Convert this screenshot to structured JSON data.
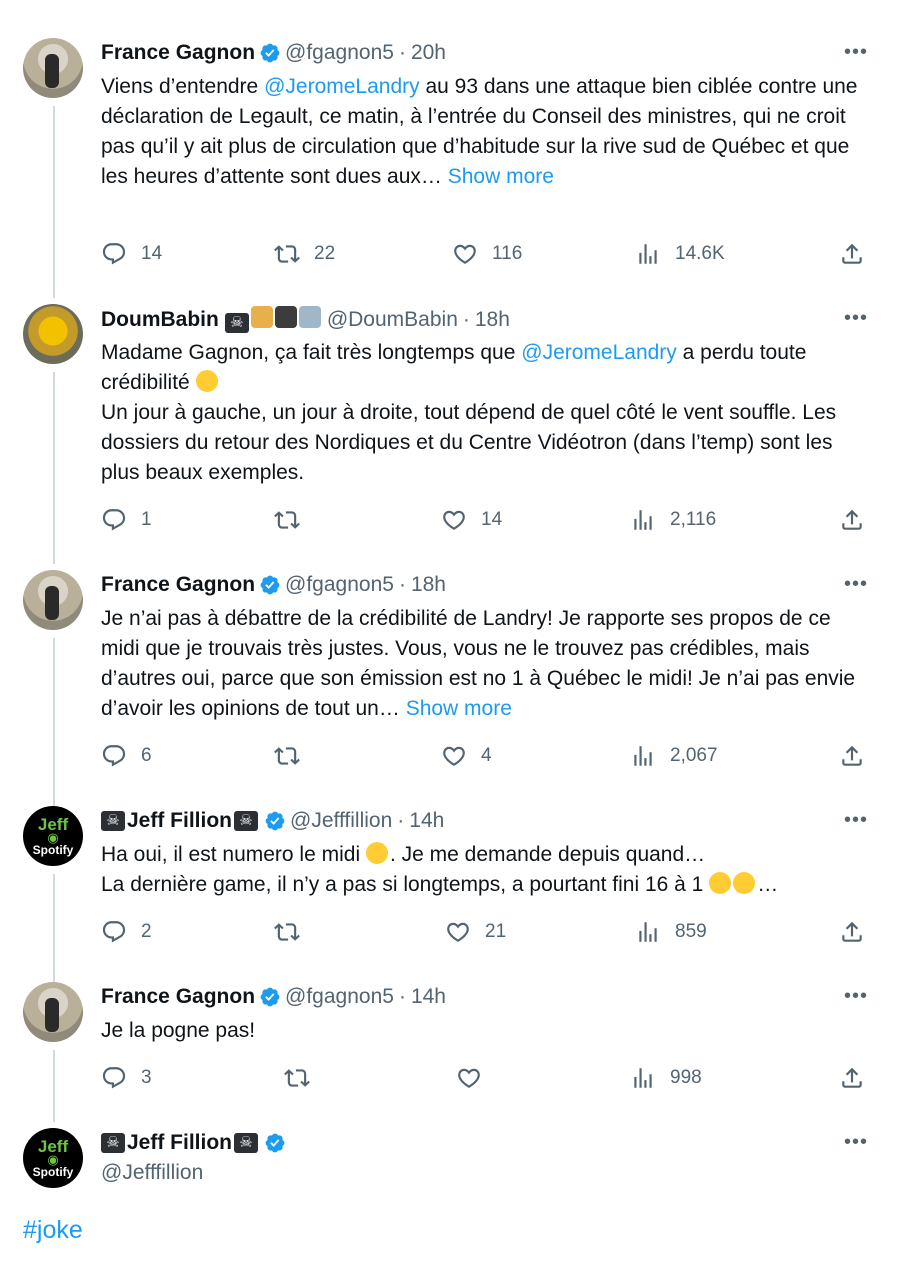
{
  "colors": {
    "accent": "#1d9bf0",
    "secondary": "#536471",
    "text": "#0f1419",
    "thread_line": "#cfd9de"
  },
  "tweets": [
    {
      "name": "France Gagnon",
      "handle": "@fgagnon5",
      "time": "20h",
      "text_before": "Viens d’entendre ",
      "mention": "@JeromeLandry",
      "text_after": " au 93 dans une attaque bien ciblée contre une déclaration de Legault, ce matin, à l’entrée du Conseil des ministres, qui ne croit pas qu’il y ait plus de circulation que d’habitude sur la rive sud de Québec et que les heures d’attente sont dues aux… ",
      "show_more": "Show more",
      "replies": "14",
      "reposts": "22",
      "likes": "116",
      "views": "14.6K"
    },
    {
      "name": "DoumBabin",
      "handle": "@DoumBabin",
      "time": "18h",
      "line1_before": "Madame Gagnon, ça fait très longtemps que ",
      "mention": "@JeromeLandry",
      "line1_after": " a perdu toute crédibilité",
      "line2": "Un jour à gauche, un jour à droite, tout dépend de quel côté le vent souffle. Les dossiers du retour des Nordiques et du Centre Vidéotron (dans l’temp) sont les plus beaux exemples.",
      "replies": "1",
      "reposts": "",
      "likes": "14",
      "views": "2,116"
    },
    {
      "name": "France Gagnon",
      "handle": "@fgagnon5",
      "time": "18h",
      "text": "Je n’ai pas à débattre de la crédibilité de Landry! Je rapporte ses propos de ce midi que je trouvais très  justes. Vous, vous ne le trouvez pas crédibles, mais d’autres oui, parce que son émission est no 1 à Québec le midi! Je n’ai pas envie d’avoir les opinions de tout un… ",
      "show_more": "Show more",
      "replies": "6",
      "reposts": "",
      "likes": "4",
      "views": "2,067"
    },
    {
      "name": "Jeff Fillion",
      "handle": "@Jefffillion",
      "time": "14h",
      "line1_before": "Ha oui, il est numero le midi ",
      "line1_after": ". Je me demande depuis quand…",
      "line2_before": "La dernière game,  il n’y a pas si longtemps, a pourtant fini 16 à 1 ",
      "line2_after": "…",
      "replies": "2",
      "reposts": "",
      "likes": "21",
      "views": "859"
    },
    {
      "name": "France Gagnon",
      "handle": "@fgagnon5",
      "time": "14h",
      "text": "Je la pogne pas!",
      "replies": "3",
      "reposts": "",
      "likes": "",
      "views": "998"
    },
    {
      "name": "Jeff Fillion",
      "handle": "@Jefffillion"
    }
  ],
  "avatar_jeff": {
    "line1": "Jeff",
    "line3": "Spotify"
  },
  "pirate_glyph": "☠",
  "hashtag": "#joke"
}
